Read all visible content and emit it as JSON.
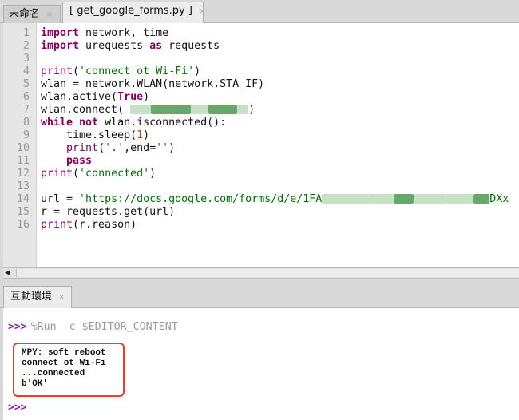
{
  "tabs": [
    {
      "label": "未命名",
      "close": "×"
    },
    {
      "label": "[ get_google_forms.py ]",
      "close": "×"
    }
  ],
  "code_lines": [
    [
      [
        "import",
        "kw"
      ],
      [
        " network, time",
        ""
      ]
    ],
    [
      [
        "import",
        "kw"
      ],
      [
        " urequests ",
        ""
      ],
      [
        "as",
        "kw"
      ],
      [
        " requests",
        ""
      ]
    ],
    [],
    [
      [
        "print",
        "bi"
      ],
      [
        "(",
        ""
      ],
      [
        "'connect ot Wi-Fi'",
        "str"
      ],
      [
        ")",
        ""
      ]
    ],
    [
      [
        "wlan = network.WLAN(network.STA_IF)",
        ""
      ]
    ],
    [
      [
        "wlan.active(",
        ""
      ],
      [
        "True",
        "kw"
      ],
      [
        ")",
        ""
      ]
    ],
    [
      [
        "wlan.connect( ",
        ""
      ],
      [
        "@redacted",
        ""
      ],
      [
        ")",
        ""
      ]
    ],
    [
      [
        "while",
        "kw"
      ],
      [
        " ",
        ""
      ],
      [
        "not",
        "kw"
      ],
      [
        " wlan.isconnected():",
        ""
      ]
    ],
    [
      [
        "    time.sleep(",
        ""
      ],
      [
        "1",
        "num"
      ],
      [
        ")",
        ""
      ]
    ],
    [
      [
        "    ",
        ""
      ],
      [
        "print",
        "bi"
      ],
      [
        "(",
        ""
      ],
      [
        "'.'",
        "str"
      ],
      [
        ",end=",
        ""
      ],
      [
        "''",
        "str"
      ],
      [
        ")",
        ""
      ]
    ],
    [
      [
        "    ",
        ""
      ],
      [
        "pass",
        "kw"
      ]
    ],
    [
      [
        "print",
        "bi"
      ],
      [
        "(",
        ""
      ],
      [
        "'connected'",
        "str"
      ],
      [
        ")",
        ""
      ]
    ],
    [],
    [
      [
        "url = ",
        ""
      ],
      [
        "'https://docs.google.com/forms/d/e/1FA",
        "str"
      ],
      [
        "@redacted",
        ""
      ],
      [
        "DXx",
        "str"
      ]
    ],
    [
      [
        "r = requests.get(url)",
        ""
      ]
    ],
    [
      [
        "print",
        "bi"
      ],
      [
        "(r.reason)",
        ""
      ]
    ]
  ],
  "shell": {
    "tab_label": "互動環境",
    "tab_close": "×",
    "prompt": ">>>",
    "command": "%Run -c $EDITOR_CONTENT",
    "output": [
      "MPY: soft reboot",
      "connect ot Wi-Fi",
      "...connected",
      "b'OK'"
    ]
  },
  "colors": {
    "keyword": "#870060",
    "string": "#007000",
    "number": "#c04000",
    "highlight_box": "#f03a2a",
    "prompt": "#8a1aa0"
  }
}
